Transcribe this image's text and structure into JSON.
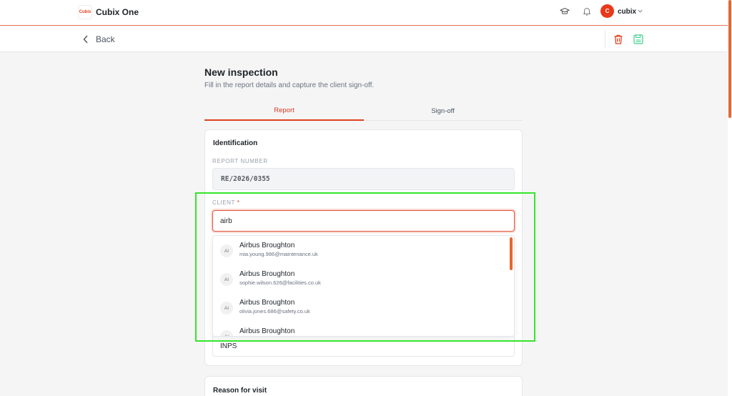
{
  "app": {
    "logo_text": "Cubix",
    "name": "Cubix One"
  },
  "header": {
    "icons": [
      "graduation-cap-icon",
      "bell-icon"
    ],
    "user": {
      "initial": "C",
      "name": "cubix"
    }
  },
  "subbar": {
    "back_label": "Back",
    "actions": [
      "delete-icon",
      "save-icon"
    ]
  },
  "page": {
    "title": "New inspection",
    "subtitle": "Fill in the report details and capture the client sign-off."
  },
  "tabs": [
    {
      "label": "Report",
      "active": true
    },
    {
      "label": "Sign-off",
      "active": false
    }
  ],
  "identification": {
    "title": "Identification",
    "report_number": {
      "label": "REPORT NUMBER",
      "value": "RE/2026/0355"
    },
    "client": {
      "label": "CLIENT",
      "required_mark": "*",
      "value": "airb",
      "suggestions": [
        {
          "initials": "AI",
          "name": "Airbus Broughton",
          "email": "mia.young.986@maintenance.uk"
        },
        {
          "initials": "AI",
          "name": "Airbus Broughton",
          "email": "sophie.wilson.626@facilities.co.uk"
        },
        {
          "initials": "AI",
          "name": "Airbus Broughton",
          "email": "olivia.jones.686@safety.co.uk"
        },
        {
          "initials": "AI",
          "name": "Airbus Broughton",
          "email": ""
        }
      ]
    },
    "partial_field_value": "INPS"
  },
  "reason_section": {
    "title": "Reason for visit"
  },
  "colors": {
    "accent": "#e0401e",
    "highlight": "#35e62b",
    "save": "#3ecf8e"
  }
}
